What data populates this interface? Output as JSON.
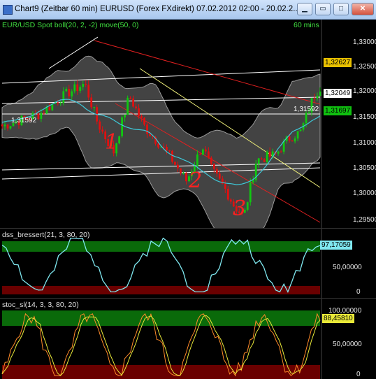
{
  "window": {
    "title": "Chart9 (Zeitbar 60 min)  EURUSD (Forex FXdirekt) 07.02.2012 02:00 - 20.02.2...",
    "buttons": {
      "minimize": "▁",
      "restore": "▭",
      "maximize": "□",
      "close": "✕"
    }
  },
  "main_pane": {
    "label": "EUR/USD Spot boll(20, 2, -2) move(50, 0)",
    "timeframe": "60 mins",
    "y_ticks": [
      "1,33000",
      "1,32500",
      "1,32000",
      "1,31500",
      "1,31000",
      "1,30500",
      "1,30000",
      "1,29500"
    ],
    "price_markers": {
      "last": "1,32627",
      "upper_line": "1,32049",
      "mid_line": "1,31697",
      "support": "1,31592",
      "left_support": "1,31592"
    },
    "annotations": [
      "1",
      "2",
      "3"
    ]
  },
  "dss_pane": {
    "label": "dss_bressert(21, 3, 80, 20)",
    "y_ticks": [
      "50,00000",
      "0"
    ],
    "value": "97,17059"
  },
  "stoc_pane": {
    "label": "stoc_sl(14, 3, 3, 80, 20)",
    "y_ticks": [
      "100,00000",
      "50,00000",
      "0"
    ],
    "value": "88,45810"
  },
  "colors": {
    "bull": "#10c810",
    "bear": "#e01010",
    "band": "#5a5a5a",
    "ma": "#3ec8d8",
    "trend": "#e02020",
    "dss": "#7fe8f0",
    "stoch_k": "#ff8a2a",
    "stoch_d": "#e8e838",
    "overbought": "#0a6a0a",
    "oversold": "#6a0000"
  }
}
